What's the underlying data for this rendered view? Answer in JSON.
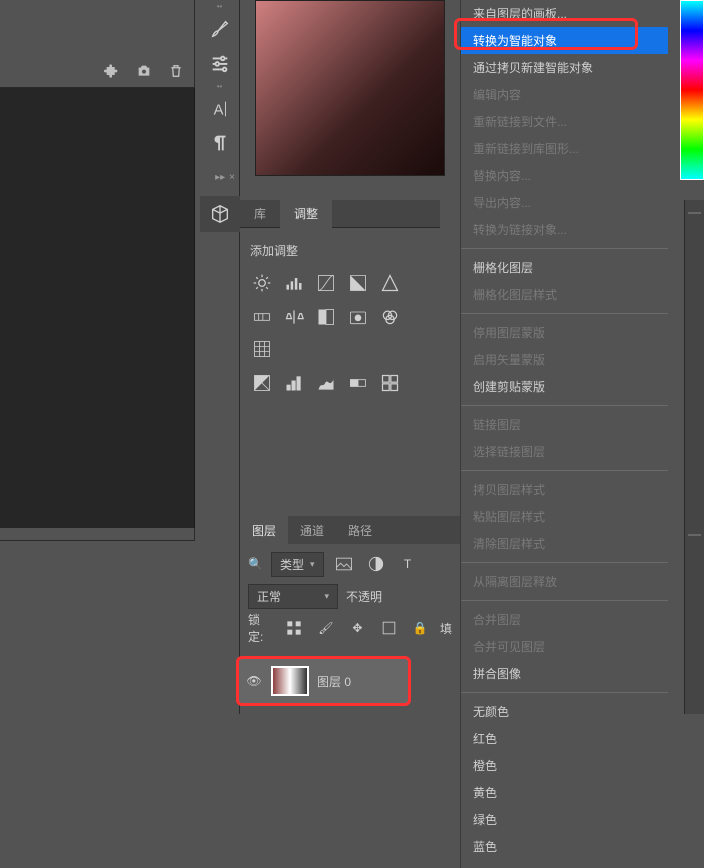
{
  "tool_col": {
    "close": "×"
  },
  "tabs": {
    "library": "库",
    "adjust": "调整"
  },
  "adjust_panel": {
    "title": "添加调整"
  },
  "layers": {
    "tab_layers": "图层",
    "tab_channels": "通道",
    "tab_paths": "路径",
    "type_label": "类型",
    "blend_mode": "正常",
    "opacity_label": "不透明",
    "lock_label": "锁定:",
    "fill_label": "填",
    "layer_name": "图层 0"
  },
  "menu": {
    "items": [
      {
        "label": "来自图层的画板...",
        "enabled": true
      },
      {
        "label": "转换为智能对象",
        "enabled": true,
        "selected": true
      },
      {
        "label": "通过拷贝新建智能对象",
        "enabled": true
      },
      {
        "label": "编辑内容",
        "enabled": false
      },
      {
        "label": "重新链接到文件...",
        "enabled": false
      },
      {
        "label": "重新链接到库图形...",
        "enabled": false
      },
      {
        "label": "替换内容...",
        "enabled": false
      },
      {
        "label": "导出内容...",
        "enabled": false
      },
      {
        "label": "转换为链接对象...",
        "enabled": false
      },
      {
        "sep": true
      },
      {
        "label": "栅格化图层",
        "enabled": true
      },
      {
        "label": "栅格化图层样式",
        "enabled": false
      },
      {
        "sep": true
      },
      {
        "label": "停用图层蒙版",
        "enabled": false
      },
      {
        "label": "启用矢量蒙版",
        "enabled": false
      },
      {
        "label": "创建剪贴蒙版",
        "enabled": true
      },
      {
        "sep": true
      },
      {
        "label": "链接图层",
        "enabled": false
      },
      {
        "label": "选择链接图层",
        "enabled": false
      },
      {
        "sep": true
      },
      {
        "label": "拷贝图层样式",
        "enabled": false
      },
      {
        "label": "粘贴图层样式",
        "enabled": false
      },
      {
        "label": "清除图层样式",
        "enabled": false
      },
      {
        "sep": true
      },
      {
        "label": "从隔离图层释放",
        "enabled": false
      },
      {
        "sep": true
      },
      {
        "label": "合并图层",
        "enabled": false
      },
      {
        "label": "合并可见图层",
        "enabled": false
      },
      {
        "label": "拼合图像",
        "enabled": true
      },
      {
        "sep": true
      },
      {
        "label": "无颜色",
        "enabled": true
      },
      {
        "label": "红色",
        "enabled": true
      },
      {
        "label": "橙色",
        "enabled": true
      },
      {
        "label": "黄色",
        "enabled": true
      },
      {
        "label": "绿色",
        "enabled": true
      },
      {
        "label": "蓝色",
        "enabled": true
      }
    ]
  }
}
